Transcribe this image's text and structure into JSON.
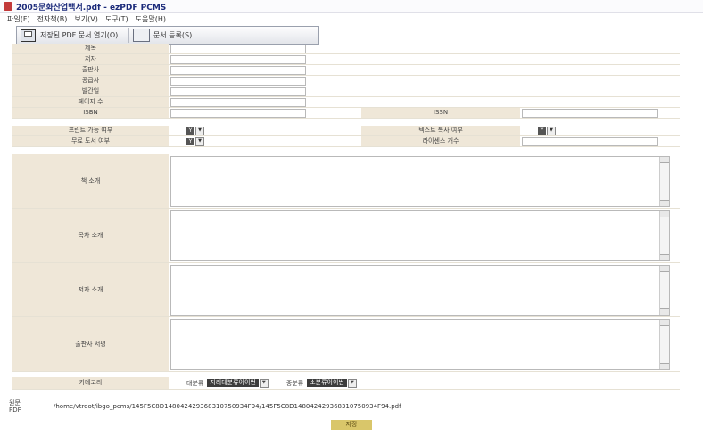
{
  "window": {
    "title": "2005문화산업백서.pdf - ezPDF PCMS"
  },
  "menu": [
    "파일(F)",
    "전자책(B)",
    "보기(V)",
    "도구(T)",
    "도움말(H)"
  ],
  "toolbar": {
    "save_label": "저장된 PDF 문서 열기(O)...",
    "register_label": "문서 등록(S)"
  },
  "fields": [
    {
      "label": "제목"
    },
    {
      "label": "저자"
    },
    {
      "label": "출판사"
    },
    {
      "label": "공급사"
    },
    {
      "label": "발간일"
    },
    {
      "label": "페이지 수"
    }
  ],
  "isbn": {
    "left_label": "ISBN",
    "right_label": "ISSN"
  },
  "options": [
    {
      "left_label": "프린트 가능 여부",
      "left_value": "Y",
      "right_label": "텍스트 복사 여부",
      "right_value": "Y"
    },
    {
      "left_label": "무료 도서 여부",
      "left_value": "Y",
      "right_label": "라이센스 개수",
      "right_value": ""
    }
  ],
  "text_areas": [
    {
      "label": "책 소개"
    },
    {
      "label": "목차 소개"
    },
    {
      "label": "저자 소개"
    },
    {
      "label": "출판사 서평"
    }
  ],
  "category": {
    "label": "카테고리",
    "major_label": "대분류",
    "major_value": "자리대분류이이번",
    "minor_label": "중분류",
    "minor_value": "소분류이이번"
  },
  "pdf_path": {
    "label": "원문 PDF",
    "path": "/home/vtroot/ibgo_pcms/145F5C8D148042429368310750934F94/145F5C8D148042429368310750934F94.pdf"
  },
  "submit_label": "저장"
}
